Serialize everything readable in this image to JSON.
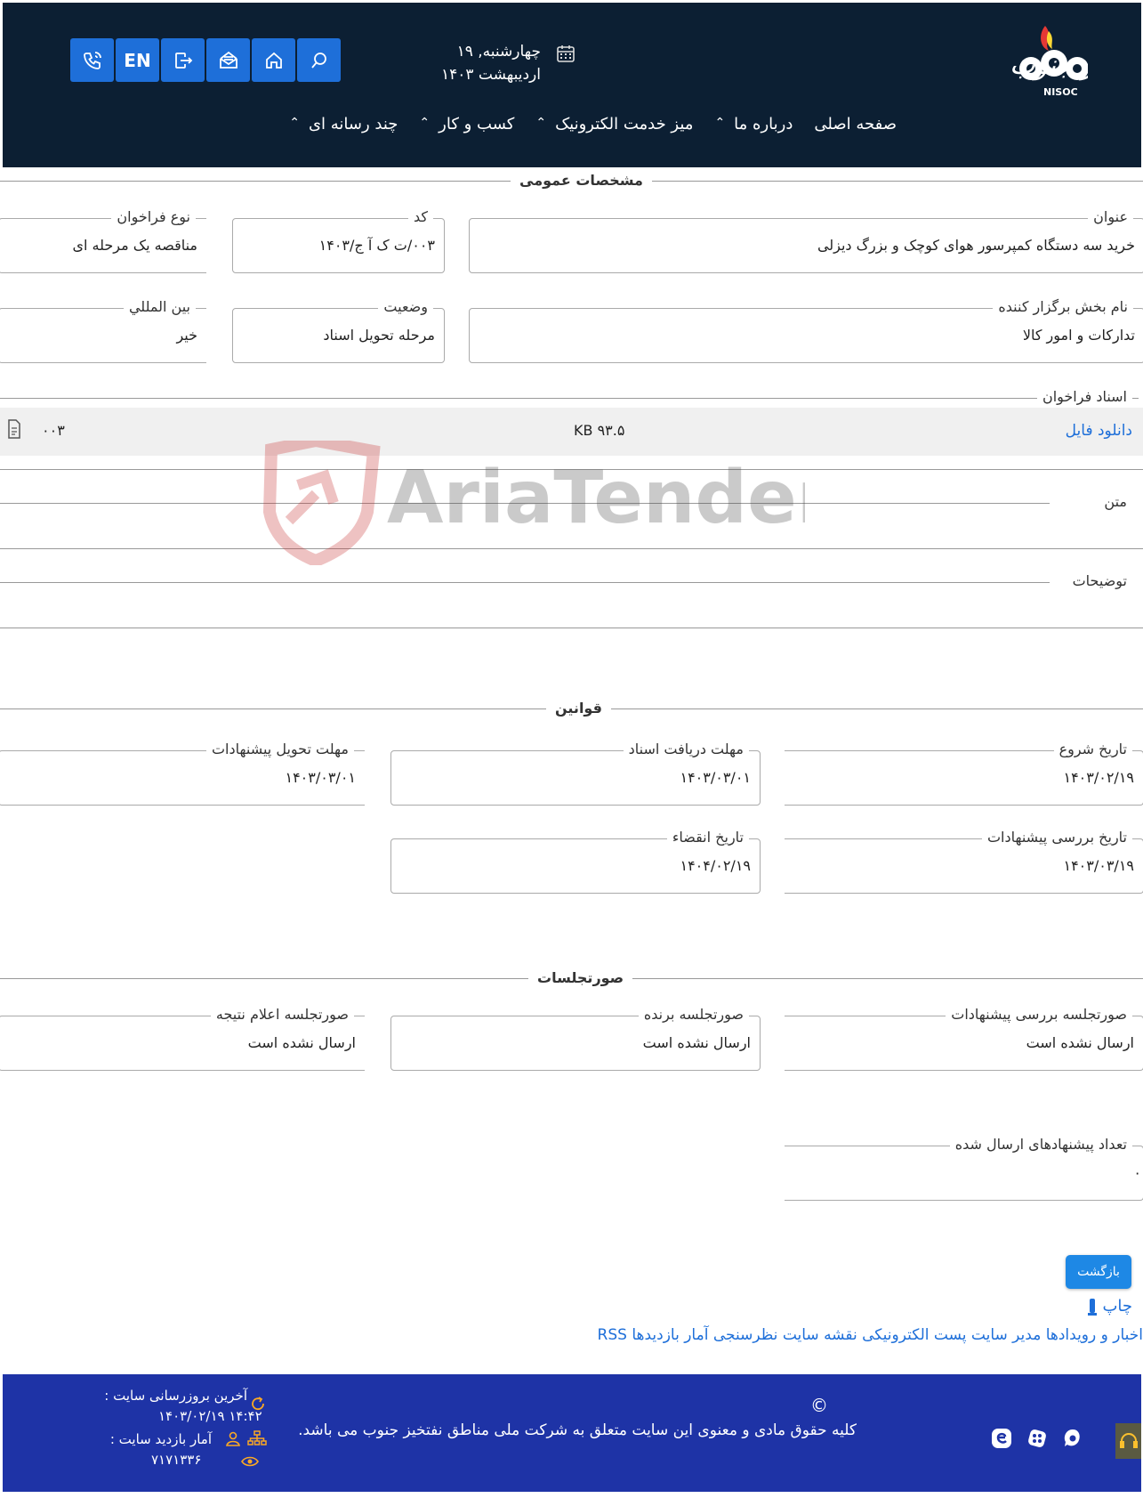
{
  "header": {
    "date": "چهارشنبه, ۱۹ اردیبهشت ۱۴۰۳",
    "lang_button": "EN",
    "logo_text": "شرکت ملی مناطق نفتخیز جنوب",
    "logo_abbr": "NISOC",
    "nav": [
      {
        "label": "صفحه اصلی",
        "has_chevron": false
      },
      {
        "label": "درباره ما",
        "has_chevron": true
      },
      {
        "label": "میز خدمت الکترونیک",
        "has_chevron": true
      },
      {
        "label": "کسب و کار",
        "has_chevron": true
      },
      {
        "label": "چند رسانه ای",
        "has_chevron": true
      }
    ]
  },
  "general": {
    "title": "مشخصات عمومی",
    "subject_label": "عنوان",
    "subject_value": "خرید سه دستگاه کمپرسور هوای کوچک و بزرگ دیزلی",
    "code_label": "کد",
    "code_value": "۰۰۳/ت ک آ ج/۱۴۰۳",
    "type_label": "نوع فراخوان",
    "type_value": "مناقصه یک مرحله ای",
    "dept_label": "نام بخش برگزار کننده",
    "dept_value": "تدارکات و امور کالا",
    "status_label": "وضعیت",
    "status_value": "مرحله تحویل اسناد",
    "intl_label": "بین المللي",
    "intl_value": "خیر",
    "docs_label": "اسناد فراخوان",
    "file_download": "دانلود فایل",
    "file_size": "۹۳.۵ KB",
    "file_name": "۰۰۳",
    "text_label": "متن",
    "desc_label": "توضیحات"
  },
  "rules": {
    "title": "قوانین",
    "start_label": "تاریخ شروع",
    "start_value": "۱۴۰۳/۰۲/۱۹",
    "receive_label": "مهلت دریافت اسناد",
    "receive_value": "۱۴۰۳/۰۳/۰۱",
    "submit_label": "مهلت تحویل پیشنهادات",
    "submit_value": "۱۴۰۳/۰۳/۰۱",
    "review_label": "تاریخ بررسی پیشنهادات",
    "review_value": "۱۴۰۳/۰۳/۱۹",
    "expire_label": "تاریخ انقضاء",
    "expire_value": "۱۴۰۴/۰۲/۱۹"
  },
  "minutes": {
    "title": "صورتجلسات",
    "review_label": "صورتجلسه بررسی پیشنهادات",
    "review_value": "ارسال نشده است",
    "winner_label": "صورتجلسه برنده",
    "winner_value": "ارسال نشده است",
    "result_label": "صورتجلسه اعلام نتیجه",
    "result_value": "ارسال نشده است",
    "count_label": "تعداد پیشنهادهای ارسال شده",
    "count_value": "۰"
  },
  "actions": {
    "back": "بازگشت",
    "print": "چاپ"
  },
  "footer_links": "اخبار و رویدادها مدیر سایت پست الکترونیکی  نقشه سایت نظرسنجی آمار بازدیدها RSS",
  "footer": {
    "copyright_symbol": "©",
    "copyright": "کلیه حقوق مادی و معنوی این سایت متعلق به شرکت ملی مناطق نفتخیز جنوب می باشد.",
    "last_update_label": "آخرین بروزرسانی سایت :",
    "last_update_value": "۱۴:۴۲ ۱۴۰۳/۰۲/۱۹",
    "visits_label": "آمار بازدید سایت :",
    "visits_value": "۷۱۷۱۳۳۶"
  },
  "watermark": "AriaTender.neT",
  "colors": {
    "header_bg": "#0c1f33",
    "button_blue": "#1e6fd9",
    "footer_bg": "#1e33a6",
    "link_blue": "#1e6fd9"
  }
}
